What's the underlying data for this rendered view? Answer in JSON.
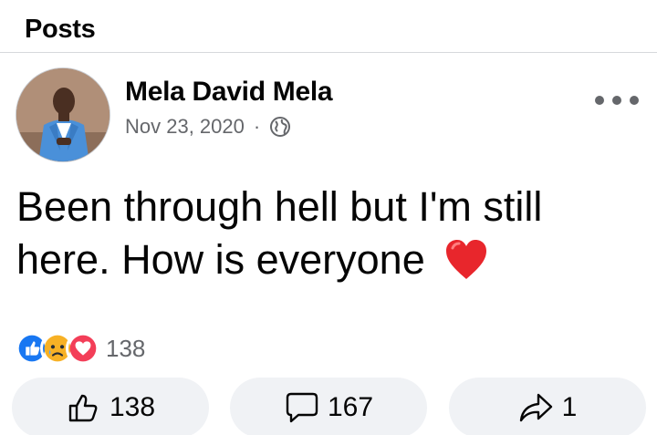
{
  "section": {
    "title": "Posts"
  },
  "post": {
    "author": "Mela David Mela",
    "date": "Nov 23, 2020",
    "separator": "·",
    "privacy_icon": "globe-icon",
    "more_icon": "more-horizontal-icon",
    "text": "Been through hell but I'm still here. How is everyone",
    "text_emoji": "red-heart-icon"
  },
  "reactions": {
    "types": [
      "like-reaction-icon",
      "sad-reaction-icon",
      "love-reaction-icon"
    ],
    "total": "138"
  },
  "actions": {
    "like": {
      "icon": "thumbs-up-icon",
      "count": "138"
    },
    "comment": {
      "icon": "comment-icon",
      "count": "167"
    },
    "share": {
      "icon": "share-icon",
      "count": "1"
    }
  },
  "colors": {
    "text_primary": "#050505",
    "text_secondary": "#65676b",
    "button_bg": "#f0f2f5",
    "like_blue": "#1877f2",
    "love_red": "#f33e58",
    "heart_red": "#e8262c"
  }
}
